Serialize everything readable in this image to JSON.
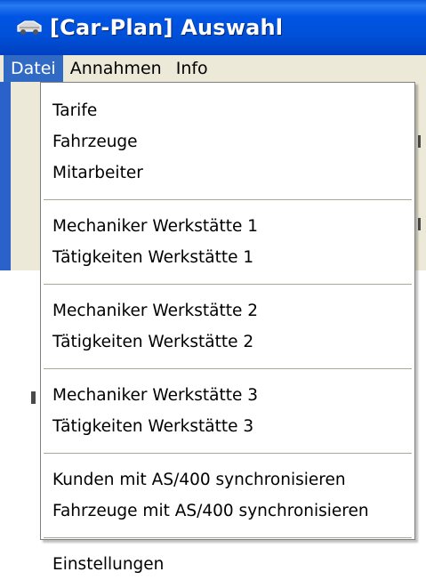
{
  "window": {
    "title": "[Car-Plan] Auswahl",
    "icon": "car-plan-app-icon"
  },
  "menubar": {
    "items": [
      {
        "label": "Datei",
        "active": true
      },
      {
        "label": "Annahmen",
        "active": false
      },
      {
        "label": "Info",
        "active": false
      }
    ]
  },
  "dropdown": {
    "groups": [
      [
        "Tarife",
        "Fahrzeuge",
        "Mitarbeiter"
      ],
      [
        "Mechaniker Werkstätte 1",
        "Tätigkeiten Werkstätte 1"
      ],
      [
        "Mechaniker Werkstätte 2",
        "Tätigkeiten Werkstätte 2"
      ],
      [
        "Mechaniker Werkstätte 3",
        "Tätigkeiten Werkstätte 3"
      ],
      [
        "Kunden mit AS/400 synchronisieren",
        "Fahrzeuge mit AS/400 synchronisieren"
      ],
      [
        "Einstellungen"
      ]
    ]
  },
  "colors": {
    "titlebar": "#0054e3",
    "menu_highlight": "#316ac5",
    "menubar_bg": "#ece9d8",
    "separator": "#aca899"
  }
}
